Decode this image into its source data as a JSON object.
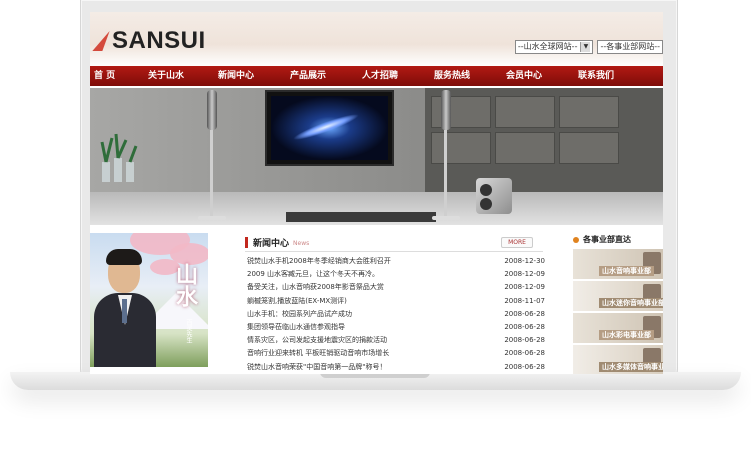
{
  "header": {
    "logo_text": "SANSUI",
    "select_global": "--山水全球网站--",
    "select_division": "--各事业部网站--"
  },
  "nav": [
    "首  页",
    "关于山水",
    "新闻中心",
    "产品展示",
    "人才招聘",
    "服务热线",
    "会员中心",
    "联系我们"
  ],
  "promo": {
    "calligraphy": "山水",
    "small_text": "百灵先生"
  },
  "news": {
    "title": "新闻中心",
    "subtitle": "News",
    "more_label": "MORE",
    "items": [
      {
        "text": "锐焚山水手机2008年冬季经销商大会胜利召开",
        "date": "2008-12-30"
      },
      {
        "text": "2009 山水客臧元旦，让这个冬天不再冷。",
        "date": "2008-12-09"
      },
      {
        "text": "备受关注，山水音响获2008年影音祭品大赏",
        "date": "2008-12-09"
      },
      {
        "text": "躺槭笼割,播放蓝陆(EX-MX测评)",
        "date": "2008-11-07"
      },
      {
        "text": "山水手机：校园系列产品试产成功",
        "date": "2008-06-28"
      },
      {
        "text": "集团领导莅临山水通信参观指导",
        "date": "2008-06-28"
      },
      {
        "text": "情系灾区，公司发起支援地震灾区的捐款活动",
        "date": "2008-06-28"
      },
      {
        "text": "音响行业迎来转机 平板旺销驱动音响市场增长",
        "date": "2008-06-28"
      },
      {
        "text": "锐焚山水音响荣获\"中国音响第一品牌\"称号！",
        "date": "2008-06-28"
      }
    ]
  },
  "divisions": {
    "title": "各事业部直达",
    "items": [
      "山水音响事业部",
      "山水迷你音响事业部",
      "山水彩电事业部",
      "山水多媒体音响事业部"
    ]
  },
  "colors": {
    "nav_red": "#9b130e",
    "logo_red": "#d44a3c",
    "news_accent": "#c2281e",
    "division_dot": "#e0831f"
  }
}
